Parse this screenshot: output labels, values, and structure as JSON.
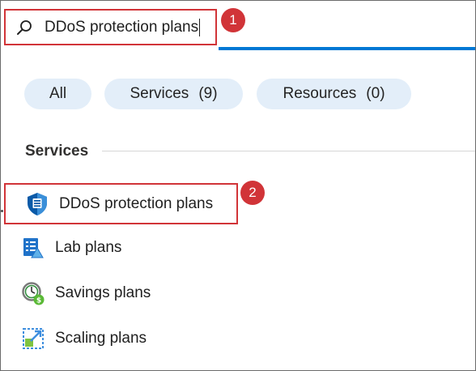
{
  "search": {
    "value": "DDoS protection plans",
    "icon": "search-icon"
  },
  "callouts": [
    "1",
    "2"
  ],
  "filters": [
    {
      "label": "All",
      "count": ""
    },
    {
      "label": "Services",
      "count": "(9)"
    },
    {
      "label": "Resources",
      "count": "(0)"
    }
  ],
  "section": {
    "title": "Services"
  },
  "services": [
    {
      "label": "DDoS protection plans",
      "icon": "shield-icon"
    },
    {
      "label": "Lab plans",
      "icon": "lab-plans-icon"
    },
    {
      "label": "Savings plans",
      "icon": "savings-plans-icon"
    },
    {
      "label": "Scaling plans",
      "icon": "scaling-plans-icon"
    }
  ],
  "colors": {
    "accent": "#0078d4",
    "highlight": "#d13438",
    "pill": "#e3eef9"
  }
}
